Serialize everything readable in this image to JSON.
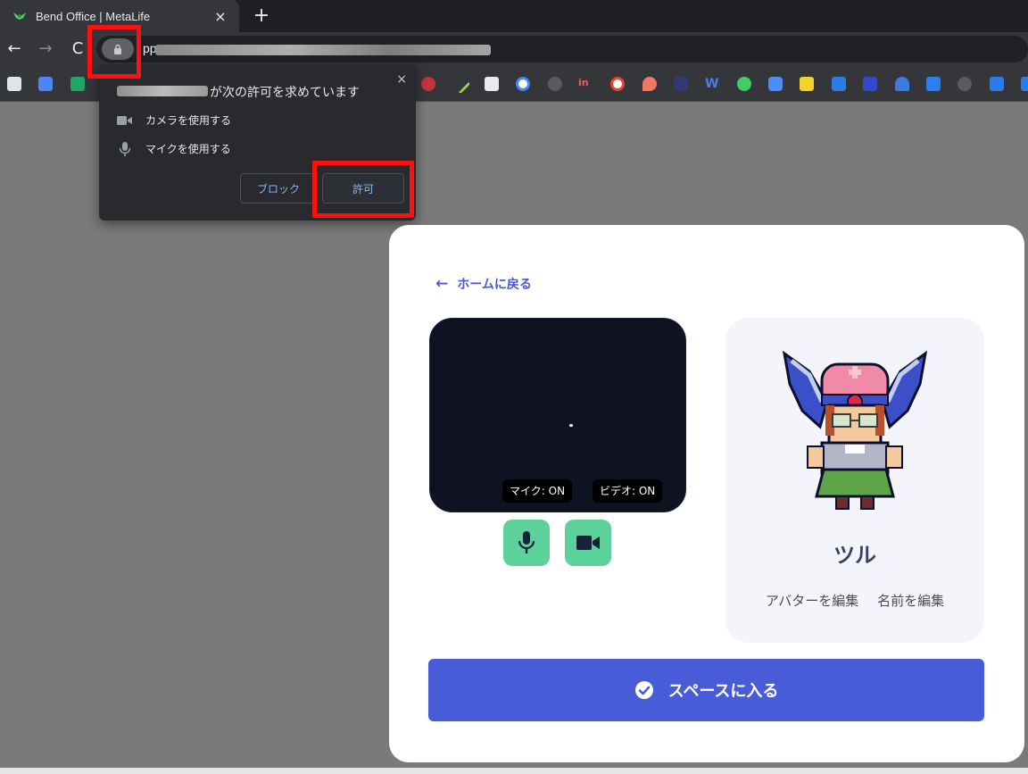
{
  "browser": {
    "tab": {
      "title": "Bend Office | MetaLife",
      "close": "×",
      "favicon": "metalife-logo-icon"
    },
    "new_tab": "+",
    "nav": {
      "back": "←",
      "forward": "→",
      "reload": "C"
    },
    "url_visible": "pp"
  },
  "bookmarks": {
    "icons": [
      "docs-icon",
      "docs-icon",
      "sheets-icon",
      "app-icon",
      "pen-icon",
      "code-icon",
      "google-icon",
      "globe-icon",
      "invision-icon",
      "google-icon",
      "pin-icon",
      "app-icon",
      "webflow-icon",
      "plus-icon",
      "chat-icon",
      "t-icon",
      "trello-icon",
      "app-icon",
      "home-icon",
      "mail-icon",
      "globe-icon",
      "trello-icon"
    ]
  },
  "permission": {
    "title": " が次の許可を求めています",
    "camera": "カメラを使用する",
    "mic": "マイクを使用する",
    "block": "ブロック",
    "allow": "許可",
    "close": "×"
  },
  "card": {
    "back": "ホームに戻る",
    "mic_status": "マイク: ON",
    "video_status": "ビデオ: ON",
    "avatar_name": "ツル",
    "edit_avatar": "アバターを編集",
    "edit_name": "名前を編集",
    "enter": "スペースに入る"
  },
  "colors": {
    "accent": "#475cd6",
    "control_green": "#5cd19a",
    "highlight_red": "#ff1010",
    "video_bg": "#0e1221"
  }
}
